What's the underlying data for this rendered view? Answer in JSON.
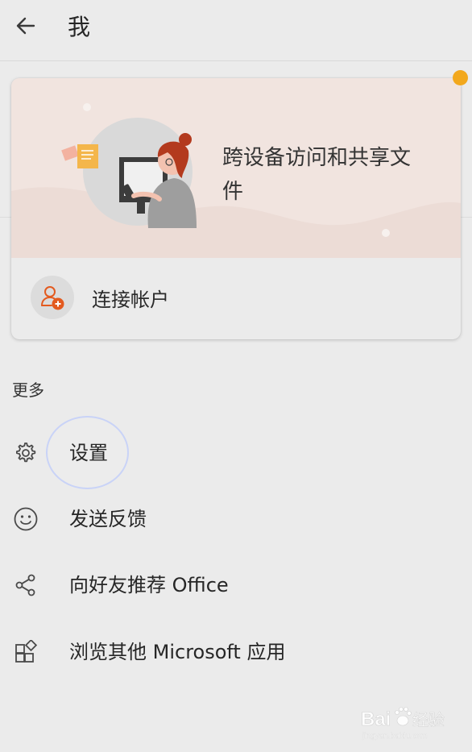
{
  "header": {
    "back_icon": "arrow-left-icon",
    "title": "我"
  },
  "notification": {
    "color": "#f2a81d"
  },
  "account_card": {
    "banner_text": "跨设备访问和共享文件",
    "banner_color": "#f1e4df",
    "connect_label": "连接帐户",
    "connect_icon": "add-person-icon",
    "accent": "#e35a1f"
  },
  "more": {
    "title": "更多",
    "items": [
      {
        "label": "设置",
        "icon": "gear-icon"
      },
      {
        "label": "发送反馈",
        "icon": "smiley-icon"
      },
      {
        "label": "向好友推荐 Office",
        "icon": "share-icon"
      },
      {
        "label": "浏览其他 Microsoft 应用",
        "icon": "apps-icon"
      }
    ]
  },
  "watermark": {
    "brand": "Bai 经验",
    "url": "jingyan.baidu.com"
  }
}
